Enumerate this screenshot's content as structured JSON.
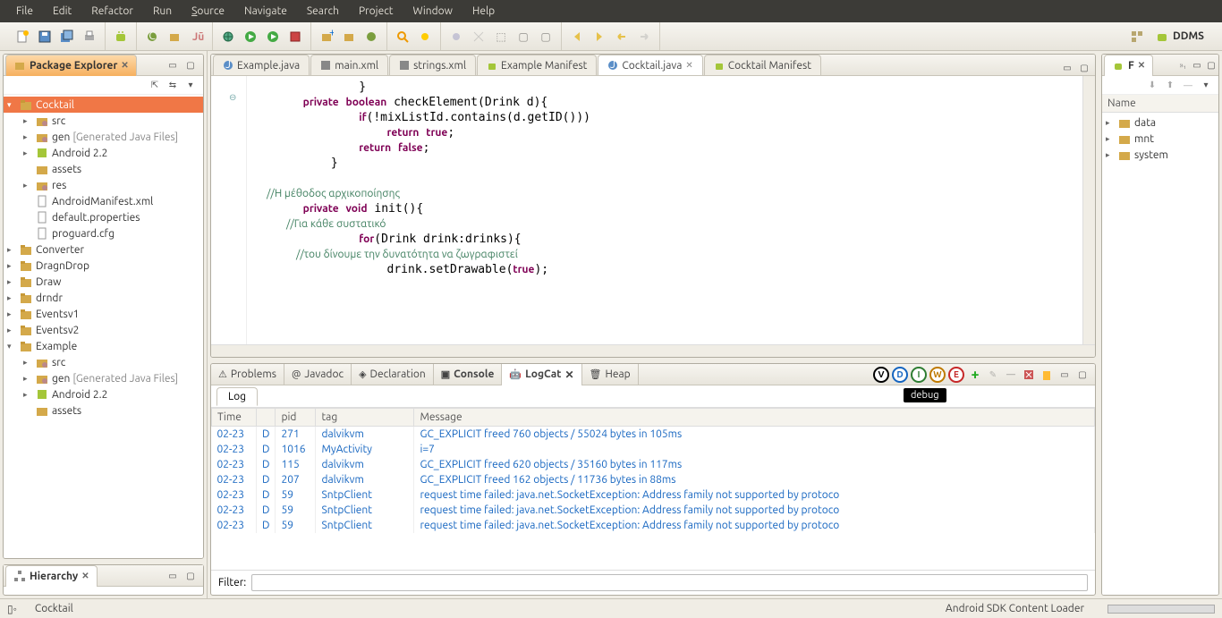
{
  "menubar": [
    "File",
    "Edit",
    "Refactor",
    "Run",
    "Source",
    "Navigate",
    "Search",
    "Project",
    "Window",
    "Help"
  ],
  "menubar_underline": {
    "Source": 0
  },
  "perspective": "DDMS",
  "package_explorer": {
    "title": "Package Explorer",
    "tree": [
      {
        "label": "Cocktail",
        "icon": "project",
        "indent": 0,
        "expanded": true,
        "selected": true
      },
      {
        "label": "src",
        "icon": "folder",
        "indent": 1,
        "expanded": false
      },
      {
        "label": "gen",
        "suffix": "[Generated Java Files]",
        "icon": "folder",
        "indent": 1,
        "expanded": false
      },
      {
        "label": "Android 2.2",
        "icon": "jar",
        "indent": 1,
        "expanded": false
      },
      {
        "label": "assets",
        "icon": "folder-plain",
        "indent": 1
      },
      {
        "label": "res",
        "icon": "folder",
        "indent": 1,
        "expanded": false
      },
      {
        "label": "AndroidManifest.xml",
        "icon": "file",
        "indent": 1
      },
      {
        "label": "default.properties",
        "icon": "file",
        "indent": 1
      },
      {
        "label": "proguard.cfg",
        "icon": "file",
        "indent": 1
      },
      {
        "label": "Converter",
        "icon": "project",
        "indent": 0,
        "expanded": false
      },
      {
        "label": "DragnDrop",
        "icon": "project",
        "indent": 0,
        "expanded": false
      },
      {
        "label": "Draw",
        "icon": "project",
        "indent": 0,
        "expanded": false
      },
      {
        "label": "drndr",
        "icon": "project",
        "indent": 0,
        "expanded": false
      },
      {
        "label": "Eventsv1",
        "icon": "project",
        "indent": 0,
        "expanded": false
      },
      {
        "label": "Eventsv2",
        "icon": "project",
        "indent": 0,
        "expanded": false
      },
      {
        "label": "Example",
        "icon": "project",
        "indent": 0,
        "expanded": true
      },
      {
        "label": "src",
        "icon": "folder",
        "indent": 1,
        "expanded": false
      },
      {
        "label": "gen",
        "suffix": "[Generated Java Files]",
        "icon": "folder",
        "indent": 1,
        "expanded": false
      },
      {
        "label": "Android 2.2",
        "icon": "jar",
        "indent": 1,
        "expanded": false
      },
      {
        "label": "assets",
        "icon": "folder-plain",
        "indent": 1
      }
    ]
  },
  "editor_tabs": [
    {
      "label": "Example.java",
      "icon": "java"
    },
    {
      "label": "main.xml",
      "icon": "xml"
    },
    {
      "label": "strings.xml",
      "icon": "xml"
    },
    {
      "label": "Example Manifest",
      "icon": "manifest"
    },
    {
      "label": "Cocktail.java",
      "icon": "java",
      "active": true,
      "close": true
    },
    {
      "label": "Cocktail Manifest",
      "icon": "manifest"
    }
  ],
  "code_lines": [
    "                }",
    "        private boolean checkElement(Drink d){",
    "                if(!mixListId.contains(d.getID()))",
    "                    return true;",
    "                return false;",
    "            }",
    "",
    "        //Η μέθοδος αρχικοποίησης",
    "        private void init(){",
    "                //Για κάθε συστατικό",
    "                for(Drink drink:drinks){",
    "                    //του δίνουμε την δυνατότητα να ζωγραφιστεί",
    "                    drink.setDrawable(true);"
  ],
  "bottom_tabs": [
    "Problems",
    "Javadoc",
    "Declaration",
    "Console",
    "LogCat",
    "Heap"
  ],
  "bottom_active": "LogCat",
  "bottom_bold": "Console",
  "log_filter_circles": [
    {
      "letter": "V",
      "color": "#000"
    },
    {
      "letter": "D",
      "color": "#1565c0"
    },
    {
      "letter": "I",
      "color": "#2e7d32"
    },
    {
      "letter": "W",
      "color": "#bf7a00"
    },
    {
      "letter": "E",
      "color": "#c62828"
    }
  ],
  "tooltip": "debug",
  "log_subtab": "Log",
  "log_columns": [
    "Time",
    "",
    "pid",
    "tag",
    "Message"
  ],
  "log_rows": [
    {
      "cls": "d",
      "time": "02-23",
      "lvl": "D",
      "pid": "271",
      "tag": "dalvikvm",
      "msg": "GC_EXPLICIT freed 760 objects / 55024 bytes in 105ms"
    },
    {
      "cls": "d sel",
      "time": "02-23",
      "lvl": "D",
      "pid": "1016",
      "tag": "MyActivity",
      "msg": "i=7"
    },
    {
      "cls": "d",
      "time": "02-23",
      "lvl": "D",
      "pid": "115",
      "tag": "dalvikvm",
      "msg": "GC_EXPLICIT freed 620 objects / 35160 bytes in 117ms"
    },
    {
      "cls": "d",
      "time": "02-23",
      "lvl": "D",
      "pid": "207",
      "tag": "dalvikvm",
      "msg": "GC_EXPLICIT freed 162 objects / 11736 bytes in 88ms"
    },
    {
      "cls": "d",
      "time": "02-23",
      "lvl": "D",
      "pid": "59",
      "tag": "SntpClient",
      "msg": "request time failed: java.net.SocketException: Address family not supported by protoco"
    },
    {
      "cls": "d",
      "time": "02-23",
      "lvl": "D",
      "pid": "59",
      "tag": "SntpClient",
      "msg": "request time failed: java.net.SocketException: Address family not supported by protoco"
    },
    {
      "cls": "d",
      "time": "02-23",
      "lvl": "D",
      "pid": "59",
      "tag": "SntpClient",
      "msg": "request time failed: java.net.SocketException: Address family not supported by protoco"
    }
  ],
  "filter_label": "Filter:",
  "hierarchy_title": "Hierarchy",
  "file_explorer": {
    "title": "F",
    "header": "Name",
    "items": [
      "data",
      "mnt",
      "system"
    ]
  },
  "statusbar": {
    "left": "Cocktail",
    "right": "Android SDK Content Loader"
  }
}
